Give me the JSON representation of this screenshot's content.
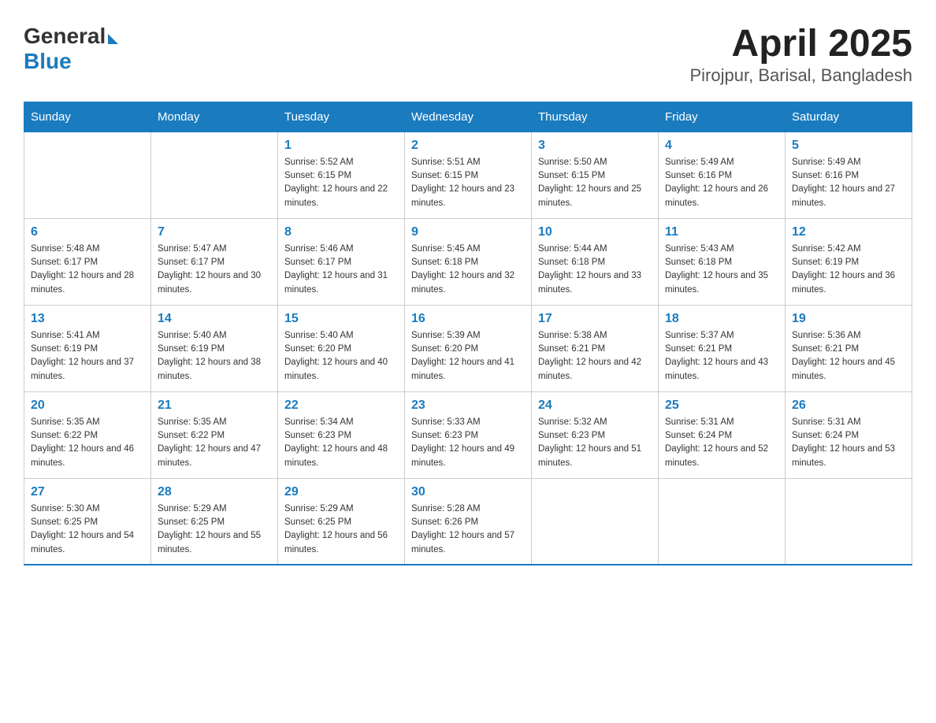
{
  "header": {
    "logo_general": "General",
    "logo_blue": "Blue",
    "title": "April 2025",
    "subtitle": "Pirojpur, Barisal, Bangladesh"
  },
  "weekdays": [
    "Sunday",
    "Monday",
    "Tuesday",
    "Wednesday",
    "Thursday",
    "Friday",
    "Saturday"
  ],
  "weeks": [
    [
      {
        "date": "",
        "sunrise": "",
        "sunset": "",
        "daylight": ""
      },
      {
        "date": "",
        "sunrise": "",
        "sunset": "",
        "daylight": ""
      },
      {
        "date": "1",
        "sunrise": "Sunrise: 5:52 AM",
        "sunset": "Sunset: 6:15 PM",
        "daylight": "Daylight: 12 hours and 22 minutes."
      },
      {
        "date": "2",
        "sunrise": "Sunrise: 5:51 AM",
        "sunset": "Sunset: 6:15 PM",
        "daylight": "Daylight: 12 hours and 23 minutes."
      },
      {
        "date": "3",
        "sunrise": "Sunrise: 5:50 AM",
        "sunset": "Sunset: 6:15 PM",
        "daylight": "Daylight: 12 hours and 25 minutes."
      },
      {
        "date": "4",
        "sunrise": "Sunrise: 5:49 AM",
        "sunset": "Sunset: 6:16 PM",
        "daylight": "Daylight: 12 hours and 26 minutes."
      },
      {
        "date": "5",
        "sunrise": "Sunrise: 5:49 AM",
        "sunset": "Sunset: 6:16 PM",
        "daylight": "Daylight: 12 hours and 27 minutes."
      }
    ],
    [
      {
        "date": "6",
        "sunrise": "Sunrise: 5:48 AM",
        "sunset": "Sunset: 6:17 PM",
        "daylight": "Daylight: 12 hours and 28 minutes."
      },
      {
        "date": "7",
        "sunrise": "Sunrise: 5:47 AM",
        "sunset": "Sunset: 6:17 PM",
        "daylight": "Daylight: 12 hours and 30 minutes."
      },
      {
        "date": "8",
        "sunrise": "Sunrise: 5:46 AM",
        "sunset": "Sunset: 6:17 PM",
        "daylight": "Daylight: 12 hours and 31 minutes."
      },
      {
        "date": "9",
        "sunrise": "Sunrise: 5:45 AM",
        "sunset": "Sunset: 6:18 PM",
        "daylight": "Daylight: 12 hours and 32 minutes."
      },
      {
        "date": "10",
        "sunrise": "Sunrise: 5:44 AM",
        "sunset": "Sunset: 6:18 PM",
        "daylight": "Daylight: 12 hours and 33 minutes."
      },
      {
        "date": "11",
        "sunrise": "Sunrise: 5:43 AM",
        "sunset": "Sunset: 6:18 PM",
        "daylight": "Daylight: 12 hours and 35 minutes."
      },
      {
        "date": "12",
        "sunrise": "Sunrise: 5:42 AM",
        "sunset": "Sunset: 6:19 PM",
        "daylight": "Daylight: 12 hours and 36 minutes."
      }
    ],
    [
      {
        "date": "13",
        "sunrise": "Sunrise: 5:41 AM",
        "sunset": "Sunset: 6:19 PM",
        "daylight": "Daylight: 12 hours and 37 minutes."
      },
      {
        "date": "14",
        "sunrise": "Sunrise: 5:40 AM",
        "sunset": "Sunset: 6:19 PM",
        "daylight": "Daylight: 12 hours and 38 minutes."
      },
      {
        "date": "15",
        "sunrise": "Sunrise: 5:40 AM",
        "sunset": "Sunset: 6:20 PM",
        "daylight": "Daylight: 12 hours and 40 minutes."
      },
      {
        "date": "16",
        "sunrise": "Sunrise: 5:39 AM",
        "sunset": "Sunset: 6:20 PM",
        "daylight": "Daylight: 12 hours and 41 minutes."
      },
      {
        "date": "17",
        "sunrise": "Sunrise: 5:38 AM",
        "sunset": "Sunset: 6:21 PM",
        "daylight": "Daylight: 12 hours and 42 minutes."
      },
      {
        "date": "18",
        "sunrise": "Sunrise: 5:37 AM",
        "sunset": "Sunset: 6:21 PM",
        "daylight": "Daylight: 12 hours and 43 minutes."
      },
      {
        "date": "19",
        "sunrise": "Sunrise: 5:36 AM",
        "sunset": "Sunset: 6:21 PM",
        "daylight": "Daylight: 12 hours and 45 minutes."
      }
    ],
    [
      {
        "date": "20",
        "sunrise": "Sunrise: 5:35 AM",
        "sunset": "Sunset: 6:22 PM",
        "daylight": "Daylight: 12 hours and 46 minutes."
      },
      {
        "date": "21",
        "sunrise": "Sunrise: 5:35 AM",
        "sunset": "Sunset: 6:22 PM",
        "daylight": "Daylight: 12 hours and 47 minutes."
      },
      {
        "date": "22",
        "sunrise": "Sunrise: 5:34 AM",
        "sunset": "Sunset: 6:23 PM",
        "daylight": "Daylight: 12 hours and 48 minutes."
      },
      {
        "date": "23",
        "sunrise": "Sunrise: 5:33 AM",
        "sunset": "Sunset: 6:23 PM",
        "daylight": "Daylight: 12 hours and 49 minutes."
      },
      {
        "date": "24",
        "sunrise": "Sunrise: 5:32 AM",
        "sunset": "Sunset: 6:23 PM",
        "daylight": "Daylight: 12 hours and 51 minutes."
      },
      {
        "date": "25",
        "sunrise": "Sunrise: 5:31 AM",
        "sunset": "Sunset: 6:24 PM",
        "daylight": "Daylight: 12 hours and 52 minutes."
      },
      {
        "date": "26",
        "sunrise": "Sunrise: 5:31 AM",
        "sunset": "Sunset: 6:24 PM",
        "daylight": "Daylight: 12 hours and 53 minutes."
      }
    ],
    [
      {
        "date": "27",
        "sunrise": "Sunrise: 5:30 AM",
        "sunset": "Sunset: 6:25 PM",
        "daylight": "Daylight: 12 hours and 54 minutes."
      },
      {
        "date": "28",
        "sunrise": "Sunrise: 5:29 AM",
        "sunset": "Sunset: 6:25 PM",
        "daylight": "Daylight: 12 hours and 55 minutes."
      },
      {
        "date": "29",
        "sunrise": "Sunrise: 5:29 AM",
        "sunset": "Sunset: 6:25 PM",
        "daylight": "Daylight: 12 hours and 56 minutes."
      },
      {
        "date": "30",
        "sunrise": "Sunrise: 5:28 AM",
        "sunset": "Sunset: 6:26 PM",
        "daylight": "Daylight: 12 hours and 57 minutes."
      },
      {
        "date": "",
        "sunrise": "",
        "sunset": "",
        "daylight": ""
      },
      {
        "date": "",
        "sunrise": "",
        "sunset": "",
        "daylight": ""
      },
      {
        "date": "",
        "sunrise": "",
        "sunset": "",
        "daylight": ""
      }
    ]
  ]
}
